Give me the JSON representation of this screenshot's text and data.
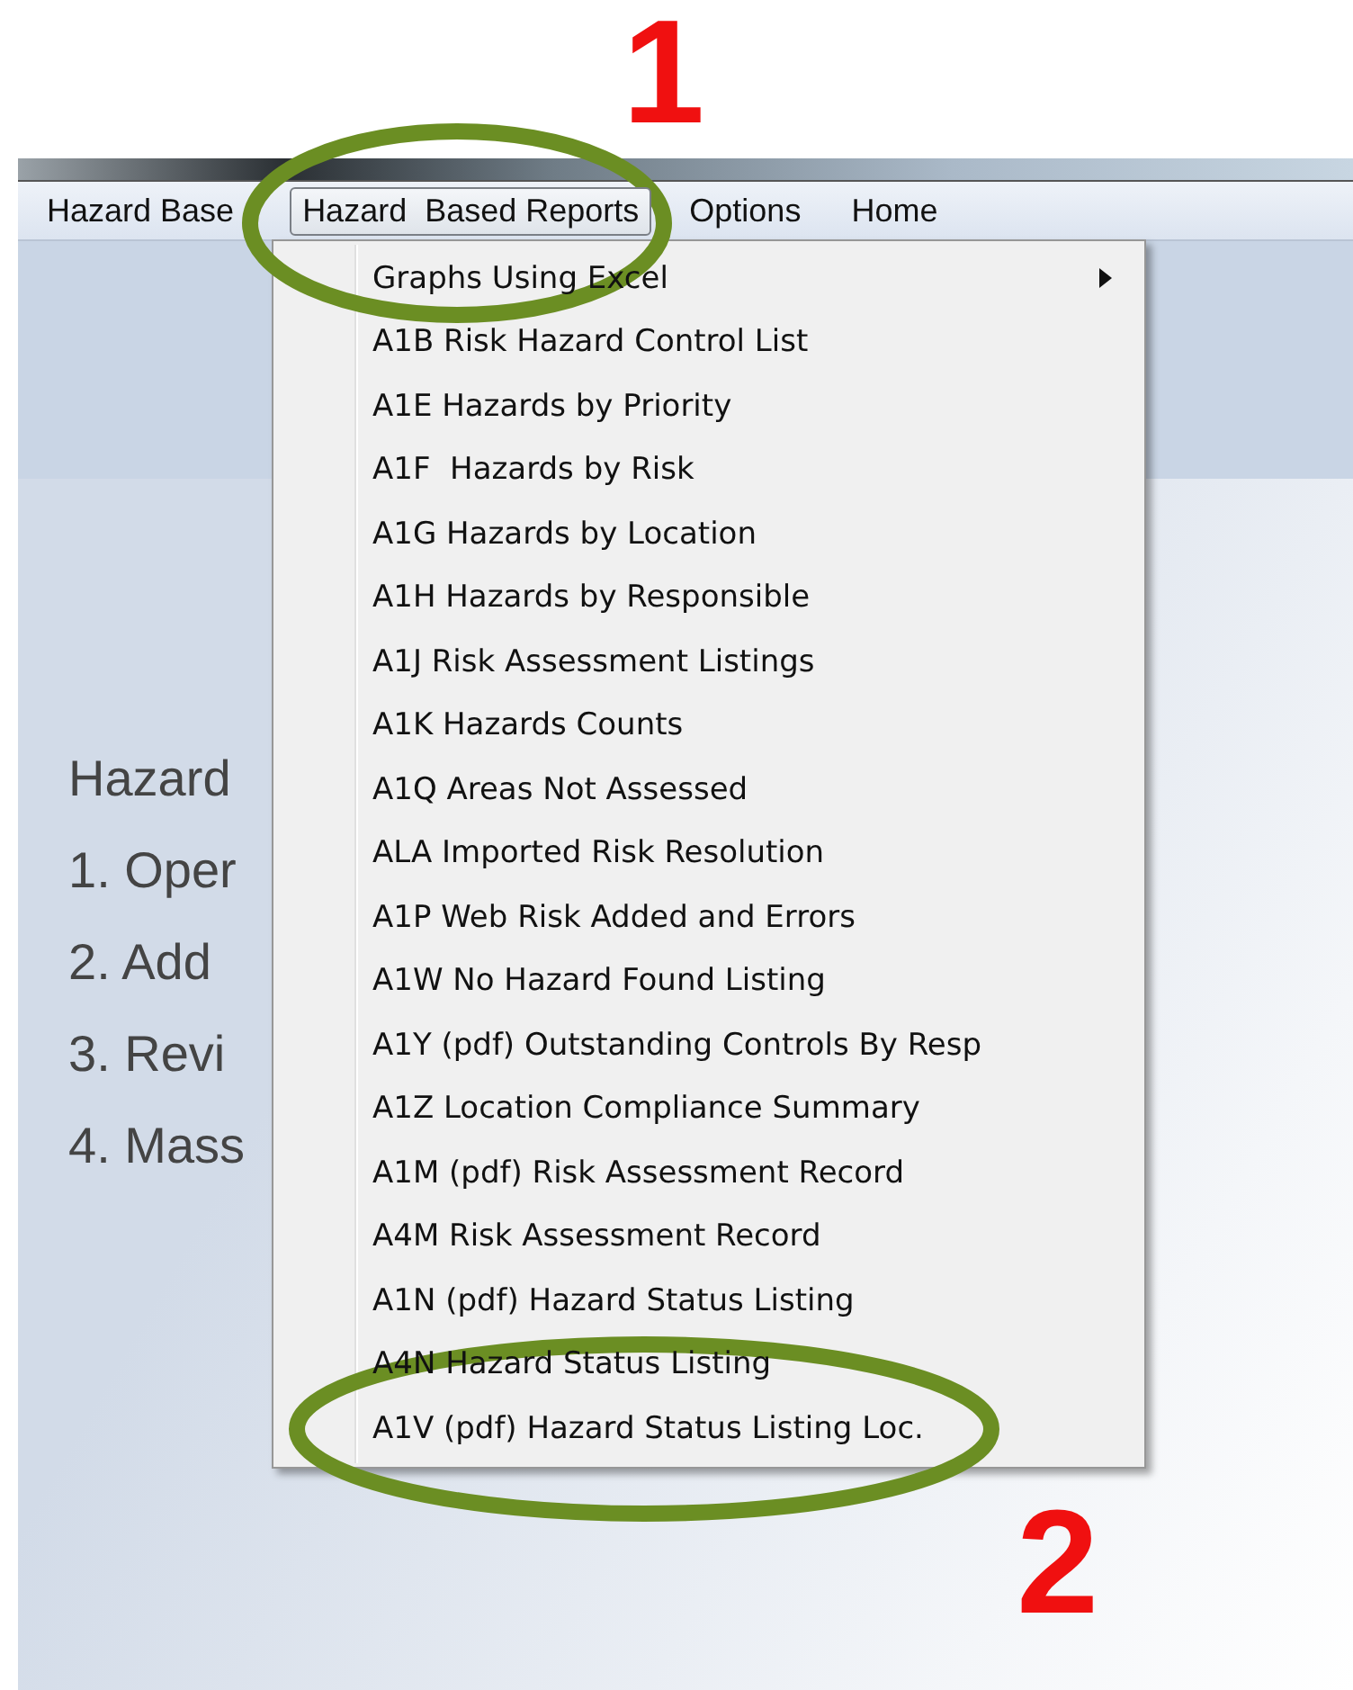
{
  "annotations": [
    {
      "label": "1"
    },
    {
      "label": "2"
    }
  ],
  "menu_bar": [
    {
      "label": "Hazard Base",
      "selected": false
    },
    {
      "label": "Hazard  Based Reports",
      "selected": true
    },
    {
      "label": "Options",
      "selected": false
    },
    {
      "label": "Home",
      "selected": false
    }
  ],
  "content_lines": [
    "Hazard",
    "1. Oper",
    "2. Add",
    "3. Revi",
    "4. Mass"
  ],
  "dropdown_menu": [
    {
      "label": "Graphs Using Excel",
      "kind": "submenu"
    },
    {
      "label": "A1B Risk Hazard Control List",
      "kind": "command"
    },
    {
      "label": "A1E Hazards by Priority",
      "kind": "command"
    },
    {
      "label": "A1F  Hazards by Risk",
      "kind": "command"
    },
    {
      "label": "A1G Hazards by Location",
      "kind": "command"
    },
    {
      "label": "A1H Hazards by Responsible",
      "kind": "command"
    },
    {
      "label": "A1J Risk Assessment Listings",
      "kind": "command"
    },
    {
      "label": "A1K Hazards Counts",
      "kind": "command"
    },
    {
      "label": "A1Q Areas Not Assessed",
      "kind": "command"
    },
    {
      "label": "ALA Imported Risk Resolution",
      "kind": "command"
    },
    {
      "label": "A1P Web Risk Added and Errors",
      "kind": "command"
    },
    {
      "label": "A1W No Hazard Found Listing",
      "kind": "command"
    },
    {
      "label": "A1Y (pdf) Outstanding Controls By Resp",
      "kind": "command"
    },
    {
      "label": "A1Z Location Compliance Summary",
      "kind": "command"
    },
    {
      "label": "A1M (pdf) Risk Assessment Record",
      "kind": "command"
    },
    {
      "label": "A4M Risk Assessment Record",
      "kind": "command"
    },
    {
      "label": "A1N (pdf) Hazard Status Listing",
      "kind": "command"
    },
    {
      "label": "A4N Hazard Status Listing",
      "kind": "command"
    },
    {
      "label": "A1V (pdf) Hazard Status Listing Loc.",
      "kind": "command"
    }
  ]
}
